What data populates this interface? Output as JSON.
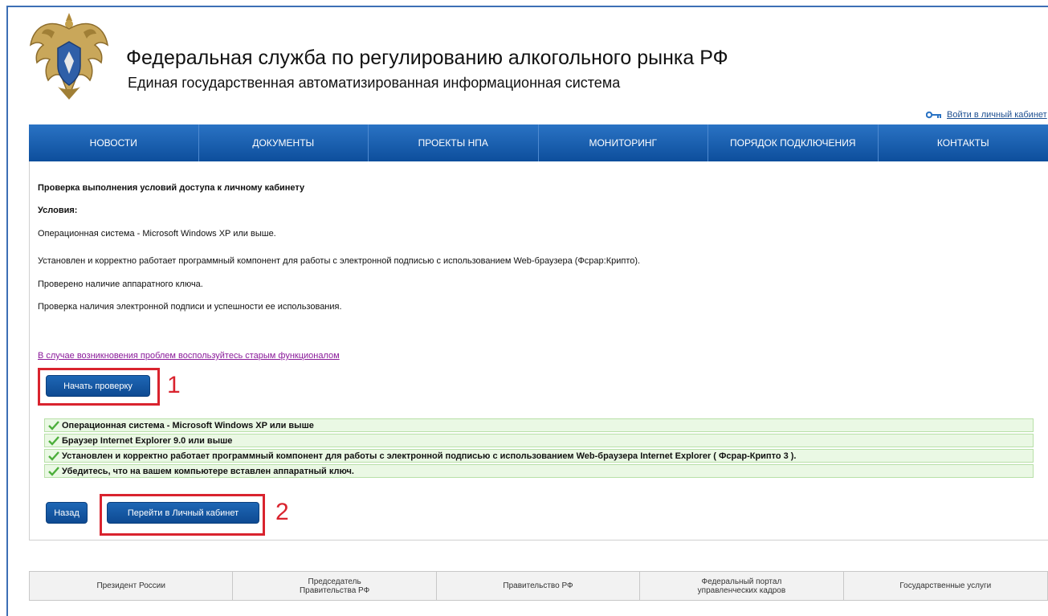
{
  "header": {
    "title": "Федеральная служба по регулированию алкогольного рынка РФ",
    "subtitle": "Единая государственная автоматизированная информационная система",
    "login_link": "Войти в личный кабинет"
  },
  "nav": {
    "items": [
      {
        "label": "НОВОСТИ"
      },
      {
        "label": "ДОКУМЕНТЫ"
      },
      {
        "label": "ПРОЕКТЫ НПА"
      },
      {
        "label": "МОНИТОРИНГ"
      },
      {
        "label": "ПОРЯДОК ПОДКЛЮЧЕНИЯ"
      },
      {
        "label": "КОНТАКТЫ"
      }
    ]
  },
  "main": {
    "heading": "Проверка выполнения условий доступа к личному кабинету",
    "conditions_label": "Условия:",
    "conditions": [
      "Операционная система - Microsoft Windows XP или выше.",
      "Установлен и корректно работает программный компонент для работы с электронной подписью с использованием Web-браузера (Фсрар:Крипто).",
      "Проверено наличие аппаратного ключа.",
      "Проверка наличия электронной подписи и успешности ее использования."
    ],
    "old_link": "В случае возникновения проблем воспользуйтесь старым функционалом",
    "start_button": "Начать проверку",
    "checks": [
      "Операционная система - Microsoft Windows XP или выше",
      "Браузер Internet Explorer 9.0 или выше",
      "Установлен и корректно работает программный компонент для работы с электронной подписью с использованием Web-браузера Internet Explorer ( Фсрар-Крипто 3 ).",
      "Убедитесь, что на вашем компьютере вставлен аппаратный ключ."
    ],
    "back_button": "Назад",
    "cabinet_button": "Перейти в Личный кабинет",
    "markers": [
      "1",
      "2"
    ]
  },
  "footer": {
    "items": [
      {
        "label": "Президент России"
      },
      {
        "label": "Председатель\nПравительства РФ"
      },
      {
        "label": "Правительство РФ"
      },
      {
        "label": "Федеральный портал\nуправленческих кадров"
      },
      {
        "label": "Государственные услуги"
      }
    ]
  },
  "colors": {
    "nav_blue": "#0d4e9c",
    "button_blue": "#0e4a92",
    "success_green": "#4cae3b",
    "highlight_red": "#d9232e",
    "link_purple": "#8a1a9a"
  },
  "icons": {
    "emblem": "double-headed-eagle-emblem-icon",
    "login": "key-icon",
    "check": "checkmark-icon"
  }
}
